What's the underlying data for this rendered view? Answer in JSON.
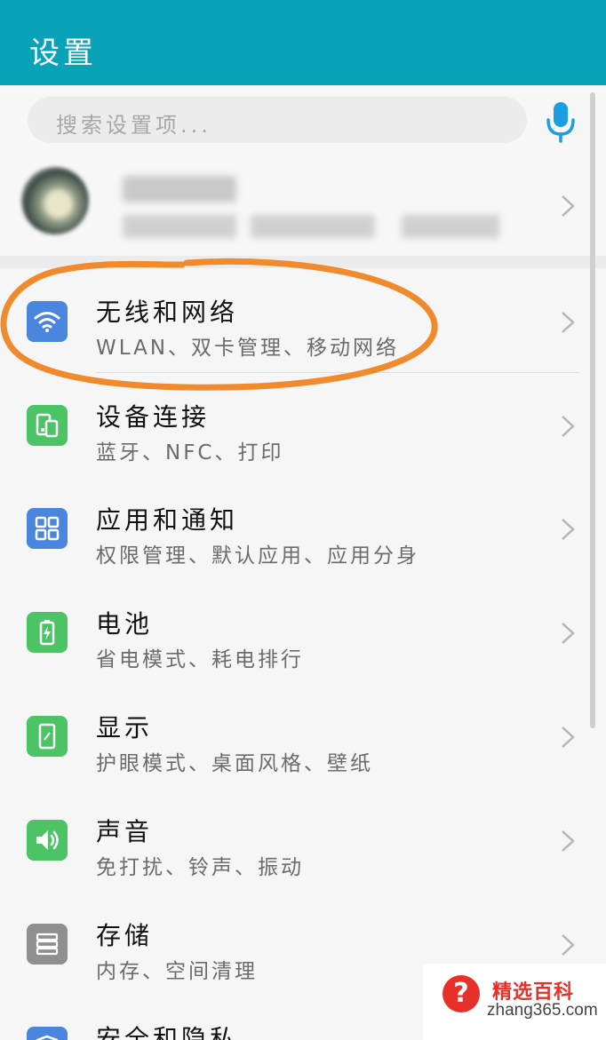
{
  "header": {
    "title": "设置",
    "bg_color": "#08a3b8"
  },
  "search": {
    "placeholder": "搜索设置项...",
    "mic_icon": "microphone-icon"
  },
  "account": {
    "avatar": "avatar"
  },
  "items": [
    {
      "title": "无线和网络",
      "subtitle": "WLAN、双卡管理、移动网络",
      "icon": "wifi-icon",
      "color": "#4a86de"
    },
    {
      "title": "设备连接",
      "subtitle": "蓝牙、NFC、打印",
      "icon": "device-connection-icon",
      "color": "#4cc466"
    },
    {
      "title": "应用和通知",
      "subtitle": "权限管理、默认应用、应用分身",
      "icon": "apps-grid-icon",
      "color": "#4a86de"
    },
    {
      "title": "电池",
      "subtitle": "省电模式、耗电排行",
      "icon": "battery-icon",
      "color": "#4cc466"
    },
    {
      "title": "显示",
      "subtitle": "护眼模式、桌面风格、壁纸",
      "icon": "display-icon",
      "color": "#4cc466"
    },
    {
      "title": "声音",
      "subtitle": "免打扰、铃声、振动",
      "icon": "speaker-icon",
      "color": "#4cc466"
    },
    {
      "title": "存储",
      "subtitle": "内存、空间清理",
      "icon": "storage-icon",
      "color": "#8f8f8f"
    },
    {
      "title": "安全和隐私",
      "subtitle": "",
      "icon": "shield-icon",
      "color": "#4a86de"
    }
  ],
  "annotation_color": "#f08a2c",
  "watermark": {
    "name": "精选百科",
    "url": "zhang365.com"
  }
}
